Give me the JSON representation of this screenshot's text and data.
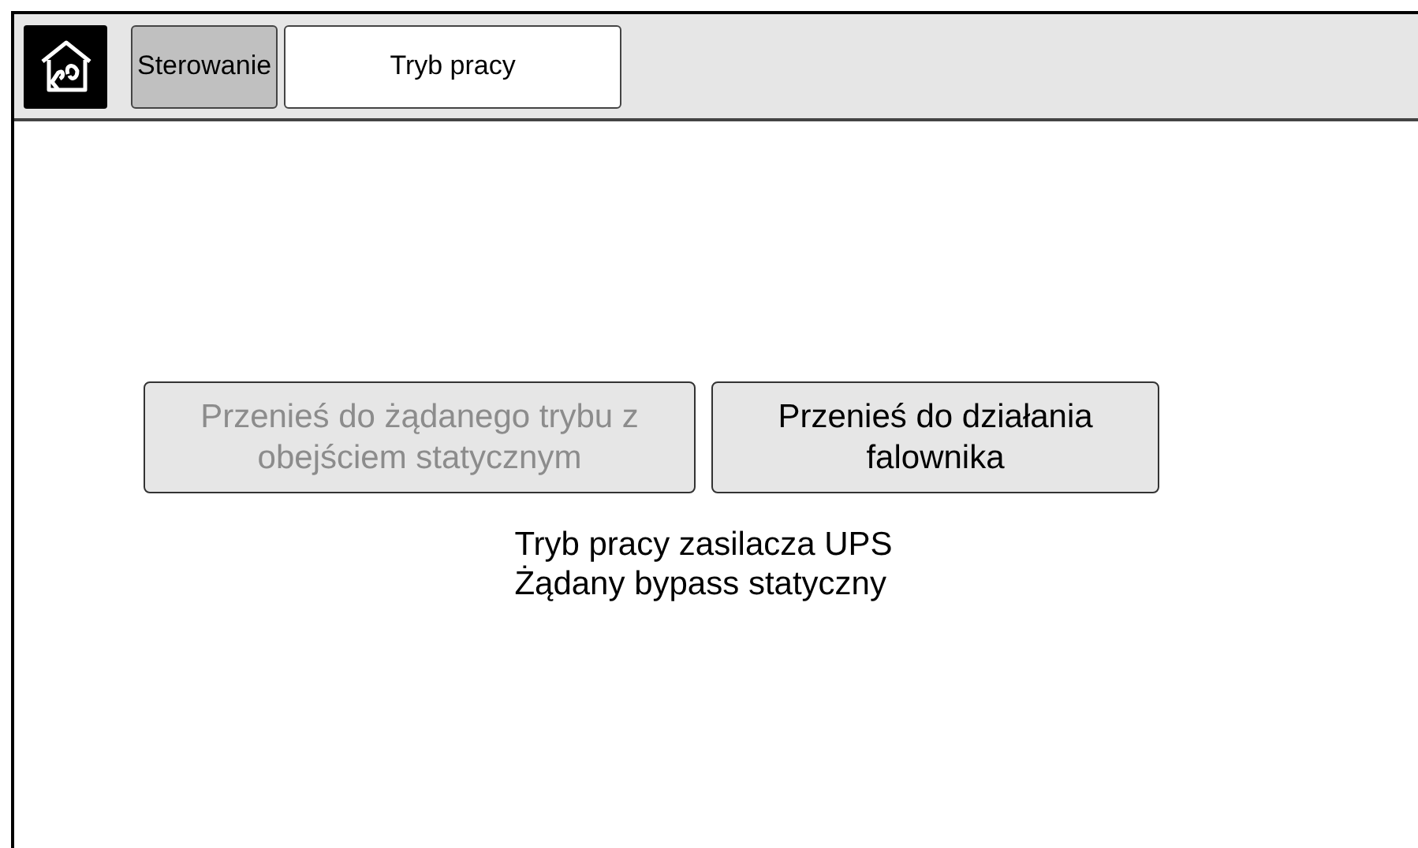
{
  "breadcrumbs": [
    {
      "label": "Sterowanie",
      "selected": false
    },
    {
      "label": "Tryb pracy",
      "selected": true
    }
  ],
  "actions": [
    {
      "label": "Przenieś do żądanego trybu z obejściem statycznym",
      "disabled": true
    },
    {
      "label": "Przenieś do działania falownika",
      "disabled": false
    }
  ],
  "status": [
    "Tryb pracy zasilacza UPS",
    "Żądany bypass statyczny"
  ]
}
